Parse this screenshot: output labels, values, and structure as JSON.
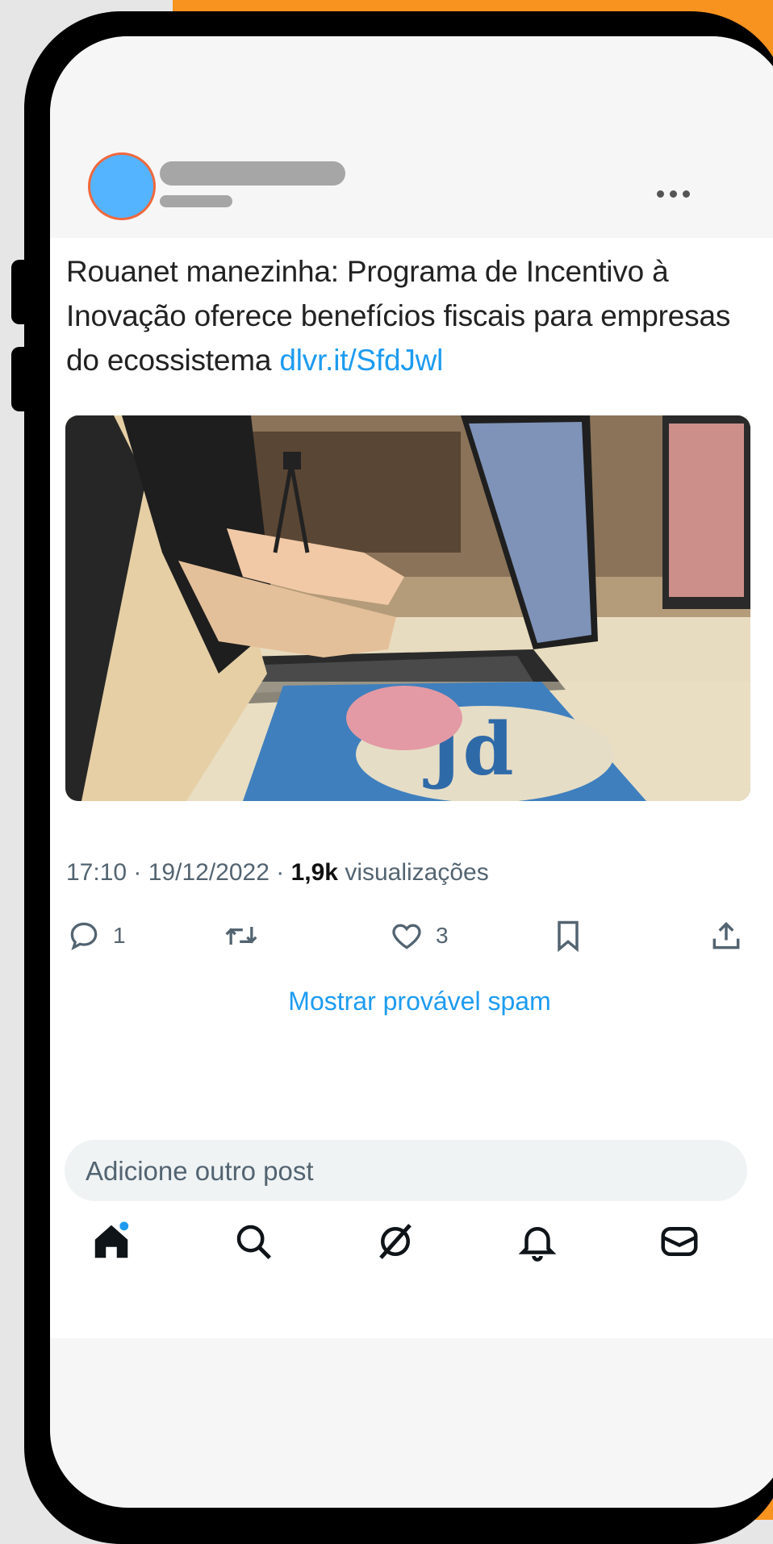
{
  "tweet": {
    "text": "Rouanet manezinha: Programa de Incentivo à Inovação oferece benefícios fiscais para empresas do ecossistema ",
    "link": "dlvr.it/SfdJwl",
    "time": "17:10",
    "date": "19/12/2022",
    "views_count": "1,9k",
    "views_label": "visualizações",
    "replies": "1",
    "likes": "3",
    "spam_link": "Mostrar provável spam"
  },
  "reply": {
    "placeholder": "Adicione outro post"
  },
  "icons": {
    "more": "more-icon",
    "reply": "reply-icon",
    "retweet": "retweet-icon",
    "like": "like-icon",
    "bookmark": "bookmark-icon",
    "share": "share-icon",
    "home": "home-icon",
    "search": "search-icon",
    "grok": "grok-icon",
    "notifications": "bell-icon",
    "messages": "mail-icon"
  },
  "colors": {
    "accent": "#1d9bf0",
    "background_orange": "#f7931e",
    "avatar": "#54b4ff",
    "avatar_ring": "#f0683d"
  }
}
